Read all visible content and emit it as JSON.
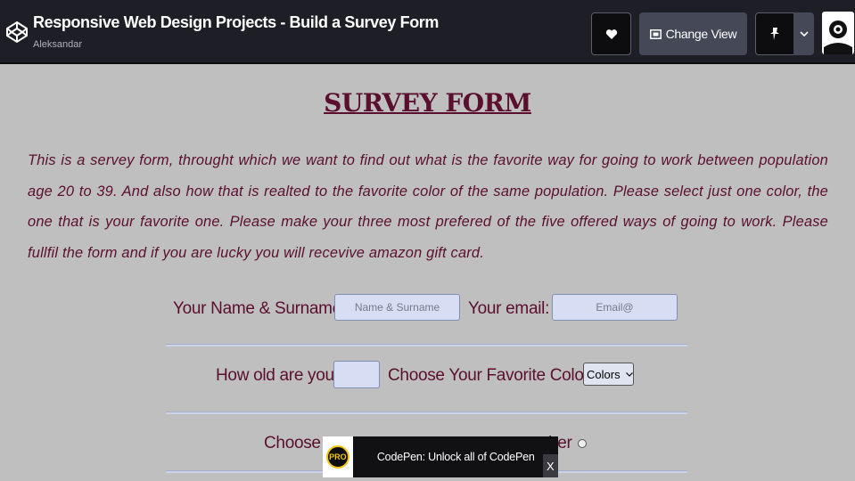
{
  "header": {
    "title": "Responsive Web Design Projects - Build a Survey Form",
    "author": "Aleksandar",
    "change_view_label": "Change View",
    "icons": [
      "codepen-logo-icon",
      "heart-icon",
      "layout-icon",
      "pin-icon",
      "chevron-down-icon",
      "avatar-icon"
    ]
  },
  "page": {
    "heading": "SURVEY FORM",
    "intro": "This is a servey form, throught which we want to find out what is the favorite way for going to work between population age 20 to 39. And also how that is realted to the favorite color of the same population. Please select just one color, the one that is your favorite one. Please make your three most prefered of the five offered ways of going to work. Please fullfil the form and if you are lucky you will recevive amazon gift card.",
    "name_label": "Your Name & Surname:",
    "name_placeholder": "Name & Surname",
    "email_label": "Your email:",
    "email_placeholder": "Email@",
    "age_label": "How old are you?",
    "color_label": "Choose Your Favorite Color:",
    "color_select_value": "Colors",
    "choose_label_start": "Choose y",
    "choose_label_end": "ther"
  },
  "banner": {
    "badge": "PRO",
    "text": "CodePen: Unlock all of CodePen",
    "close": "X"
  },
  "colors": {
    "topbar": "#1e1f26",
    "text_maroon": "#5a0f2f",
    "page_bg": "#bfbfbf",
    "input_bg": "#d7ddf3"
  }
}
